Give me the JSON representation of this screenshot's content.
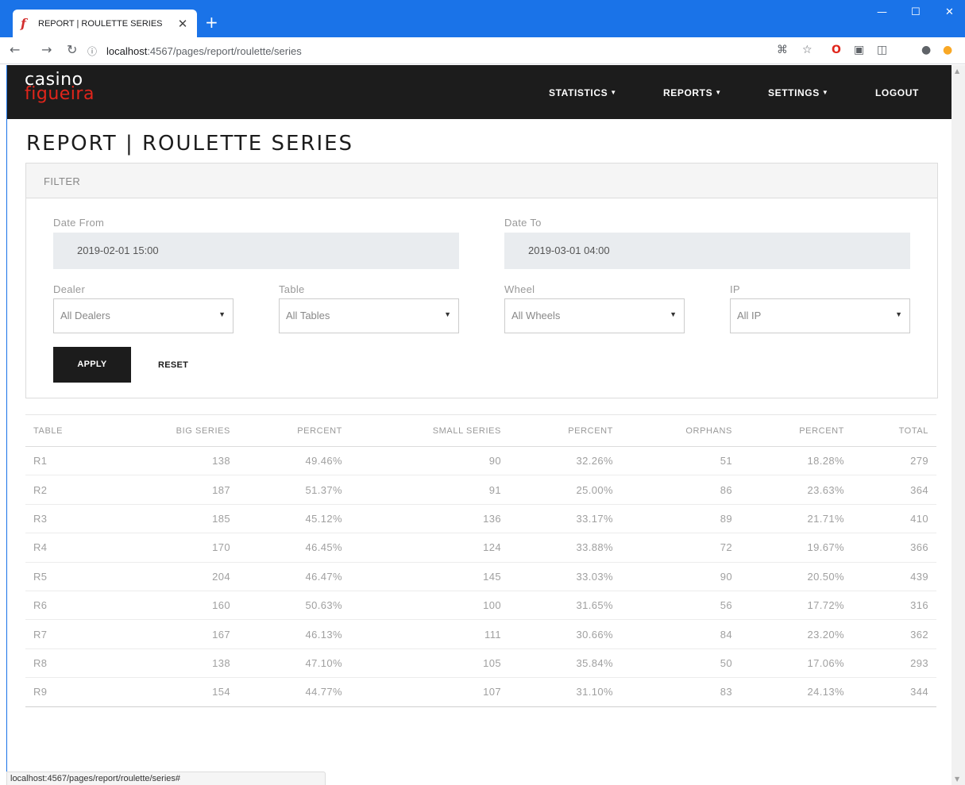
{
  "browser": {
    "tab_title": "REPORT | ROULETTE SERIES",
    "favicon_glyph": "f",
    "url_host": "localhost",
    "url_path": ":4567/pages/report/roulette/series",
    "status_url": "localhost:4567/pages/report/roulette/series#"
  },
  "navbar": {
    "logo_top": "casino",
    "logo_bottom": "figueira",
    "items": [
      {
        "label": "STATISTICS",
        "dropdown": true
      },
      {
        "label": "REPORTS",
        "dropdown": true
      },
      {
        "label": "SETTINGS",
        "dropdown": true
      },
      {
        "label": "LOGOUT",
        "dropdown": false
      }
    ]
  },
  "page": {
    "title": "REPORT | ROULETTE SERIES"
  },
  "filter": {
    "header": "FILTER",
    "date_from": {
      "label": "Date From",
      "value": "2019-02-01 15:00"
    },
    "date_to": {
      "label": "Date To",
      "value": "2019-03-01 04:00"
    },
    "dealer": {
      "label": "Dealer",
      "selected": "All Dealers"
    },
    "table": {
      "label": "Table",
      "selected": "All Tables"
    },
    "wheel": {
      "label": "Wheel",
      "selected": "All Wheels"
    },
    "ip": {
      "label": "IP",
      "selected": "All IP"
    },
    "apply_label": "APPLY",
    "reset_label": "RESET"
  },
  "report": {
    "columns": [
      "TABLE",
      "BIG SERIES",
      "PERCENT",
      "SMALL SERIES",
      "PERCENT",
      "ORPHANS",
      "PERCENT",
      "TOTAL"
    ],
    "rows": [
      [
        "R1",
        "138",
        "49.46%",
        "90",
        "32.26%",
        "51",
        "18.28%",
        "279"
      ],
      [
        "R2",
        "187",
        "51.37%",
        "91",
        "25.00%",
        "86",
        "23.63%",
        "364"
      ],
      [
        "R3",
        "185",
        "45.12%",
        "136",
        "33.17%",
        "89",
        "21.71%",
        "410"
      ],
      [
        "R4",
        "170",
        "46.45%",
        "124",
        "33.88%",
        "72",
        "19.67%",
        "366"
      ],
      [
        "R5",
        "204",
        "46.47%",
        "145",
        "33.03%",
        "90",
        "20.50%",
        "439"
      ],
      [
        "R6",
        "160",
        "50.63%",
        "100",
        "31.65%",
        "56",
        "17.72%",
        "316"
      ],
      [
        "R7",
        "167",
        "46.13%",
        "111",
        "30.66%",
        "84",
        "23.20%",
        "362"
      ],
      [
        "R8",
        "138",
        "47.10%",
        "105",
        "35.84%",
        "50",
        "17.06%",
        "293"
      ],
      [
        "R9",
        "154",
        "44.77%",
        "107",
        "31.10%",
        "83",
        "24.13%",
        "344"
      ]
    ]
  },
  "colors": {
    "chrome_blue": "#1a73e8",
    "navbar_bg": "#1c1c1c",
    "brand_red": "#e0251b"
  }
}
